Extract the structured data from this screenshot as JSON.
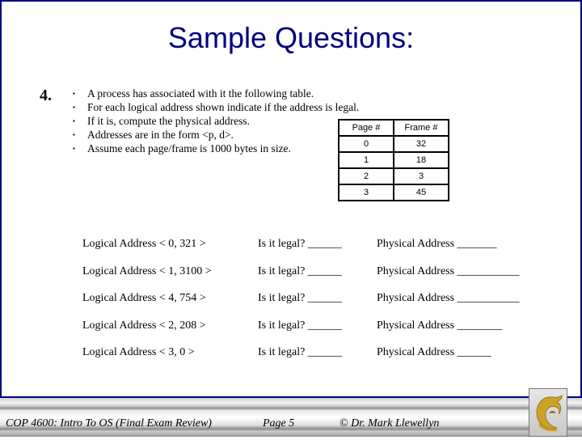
{
  "slide": {
    "title": "Sample Questions:",
    "question_number": "4.",
    "bullets": [
      "A process has associated with it the following table.",
      "For each logical address shown indicate if the address is legal.",
      "If it is, compute the physical address.",
      "Addresses are in the form <p, d>.",
      "Assume each page/frame is 1000 bytes in size."
    ],
    "page_table": {
      "headers": [
        "Page #",
        "Frame #"
      ],
      "rows": [
        [
          "0",
          "32"
        ],
        [
          "1",
          "18"
        ],
        [
          "2",
          "3"
        ],
        [
          "3",
          "45"
        ]
      ]
    },
    "questions": [
      {
        "logical": "Logical Address < 0, 321 >",
        "legal": "Is it legal?  ______",
        "physical": "Physical Address  _______"
      },
      {
        "logical": "Logical Address < 1, 3100 >",
        "legal": "Is it legal?  ______",
        "physical": "Physical Address  ___________"
      },
      {
        "logical": "Logical Address < 4, 754 >",
        "legal": "Is it legal?  ______",
        "physical": "Physical Address  ___________"
      },
      {
        "logical": "Logical Address < 2, 208 >",
        "legal": "Is it legal?  ______",
        "physical": "Physical Address  ________"
      },
      {
        "logical": "Logical Address < 3, 0 >",
        "legal": "Is it legal?  ______",
        "physical": "Physical Address  ______"
      }
    ]
  },
  "footer": {
    "course": "COP 4600: Intro To OS  (Final Exam Review)",
    "page": "Page 5",
    "author": "© Dr. Mark Llewellyn",
    "logo_icon": "ucf-pegasus-logo"
  },
  "colors": {
    "title": "#000080",
    "border": "#000080",
    "logo_gold": "#c9a227"
  }
}
